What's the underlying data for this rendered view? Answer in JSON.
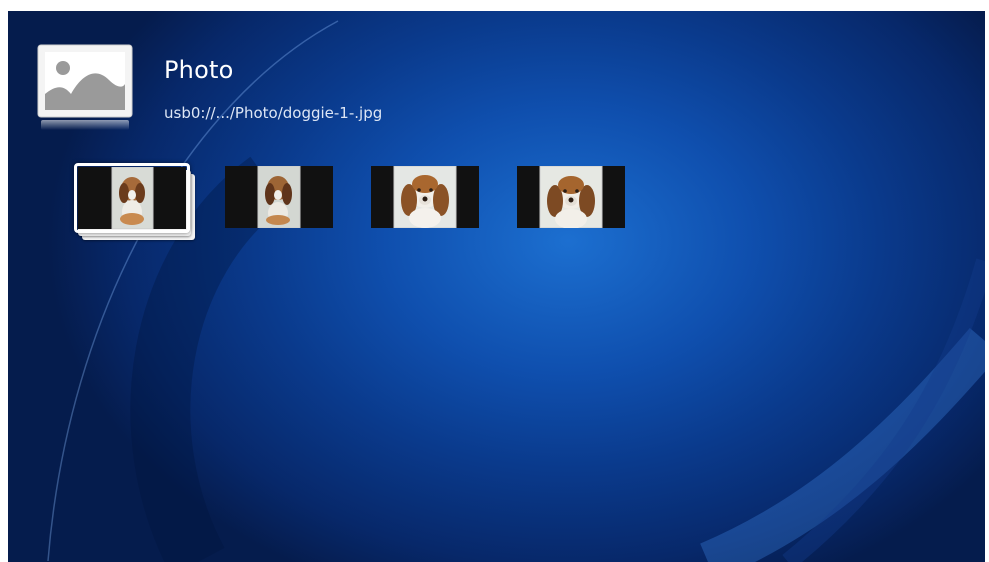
{
  "app": {
    "title": "Photo",
    "path": "usb0://.../Photo/doggie-1-.jpg"
  },
  "header": {
    "icon": "photo-icon"
  },
  "thumbnails": [
    {
      "name": "photo-thumbnail-1",
      "selected": true,
      "stacked": true
    },
    {
      "name": "photo-thumbnail-2",
      "selected": false,
      "stacked": false
    },
    {
      "name": "photo-thumbnail-3",
      "selected": false,
      "stacked": false
    },
    {
      "name": "photo-thumbnail-4",
      "selected": false,
      "stacked": false
    }
  ],
  "colors": {
    "background": "#0a3a8c",
    "highlight": "#1c6fd0",
    "text": "#ffffff"
  }
}
